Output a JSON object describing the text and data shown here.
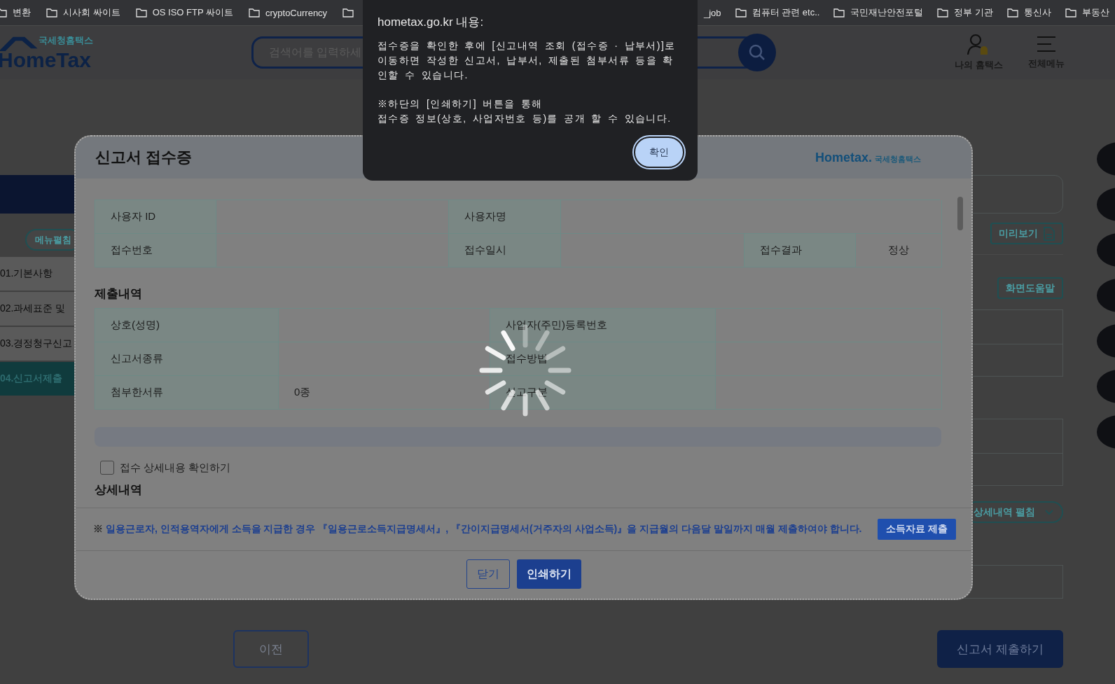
{
  "bookmarks_left": [
    {
      "label": "변환"
    },
    {
      "label": "시사회 싸이트"
    },
    {
      "label": "OS ISO FTP 싸이트"
    },
    {
      "label": "cryptoCurrency"
    }
  ],
  "bookmarks_right": [
    {
      "label": "_job"
    },
    {
      "label": "컴퓨터 관련 etc.."
    },
    {
      "label": "국민재난안전포털"
    },
    {
      "label": "정부 기관"
    },
    {
      "label": "통신사"
    },
    {
      "label": "부동산"
    }
  ],
  "header": {
    "logo_small": "국세청홈택스",
    "logo": "HomeTax",
    "search_placeholder": "검색어를 입력하세",
    "links": [
      {
        "label": "나의 홈택스",
        "kind": "my"
      },
      {
        "label": "전체메뉴",
        "kind": "menu"
      }
    ]
  },
  "sidebar": {
    "toggle": "메뉴펼침",
    "items": [
      {
        "label": "01.기본사항",
        "selected": false
      },
      {
        "label": "02.과세표준 및",
        "selected": false
      },
      {
        "label": "03.경정청구신고",
        "selected": false
      },
      {
        "label": "04.신고서제출",
        "selected": true
      }
    ]
  },
  "page": {
    "preview": "미리보기",
    "help": "화면도움말",
    "expand": "상세내역 펼침",
    "prev": "이전",
    "submit": "신고서 제출하기"
  },
  "modal": {
    "title": "신고서 접수증",
    "logo": "Hometax.",
    "logo_text": "국세청홈택스",
    "receipt_rows": [
      [
        {
          "kind": "head",
          "text": "사용자 ID"
        },
        {
          "kind": "value"
        },
        {
          "kind": "head",
          "text": "사용자명"
        },
        {
          "kind": "value",
          "colspan": 3
        }
      ],
      [
        {
          "kind": "head",
          "text": "접수번호"
        },
        {
          "kind": "value"
        },
        {
          "kind": "head",
          "text": "접수일시"
        },
        {
          "kind": "value"
        },
        {
          "kind": "head",
          "text": "접수결과"
        },
        {
          "kind": "value",
          "text": "정상"
        }
      ]
    ],
    "section": "제출내역",
    "submit_rows": [
      [
        {
          "kind": "head",
          "text": "상호(성명)"
        },
        {
          "kind": "value"
        },
        {
          "kind": "head",
          "text": "사업자(주민)등록번호"
        },
        {
          "kind": "value"
        }
      ],
      [
        {
          "kind": "head",
          "text": "신고서종류"
        },
        {
          "kind": "value"
        },
        {
          "kind": "head",
          "text": "접수방법"
        },
        {
          "kind": "value"
        }
      ],
      [
        {
          "kind": "head",
          "text": "첨부한서류"
        },
        {
          "kind": "value",
          "text": "0종"
        },
        {
          "kind": "head",
          "text": "신고구분"
        },
        {
          "kind": "value"
        }
      ]
    ],
    "checkbox": {
      "label": "접수 상세내용 확인하기",
      "checked": false
    },
    "section2": "상세내역",
    "loading": true,
    "notice": {
      "mark": "※",
      "text": "일용근로자, 인적용역자에게 소득을 지급한 경우 『일용근로소득지급명세서』, 『간이지급명세서(거주자의 사업소득)』을 지급월의 다음달 말일까지 매월 제출하여야 합니다.",
      "button": "소득자료 제출"
    },
    "buttons": [
      {
        "label": "닫기",
        "kind": "secondary"
      },
      {
        "label": "인쇄하기",
        "kind": "primary"
      }
    ]
  },
  "dialog": {
    "title": "hometax.go.kr 내용:",
    "paragraphs": [
      "접수증을 확인한 후에 [신고내역 조회 (접수증 · 납부서)]로\n이동하면 작성한 신고서, 납부서, 제출된 첨부서류 등을 확인할 수 있습니다.",
      "※하단의 [인쇄하기] 버튼을 통해\n접수증 정보(상호, 사업자번호 등)를 공개 할 수 있습니다."
    ],
    "button": "확인"
  }
}
